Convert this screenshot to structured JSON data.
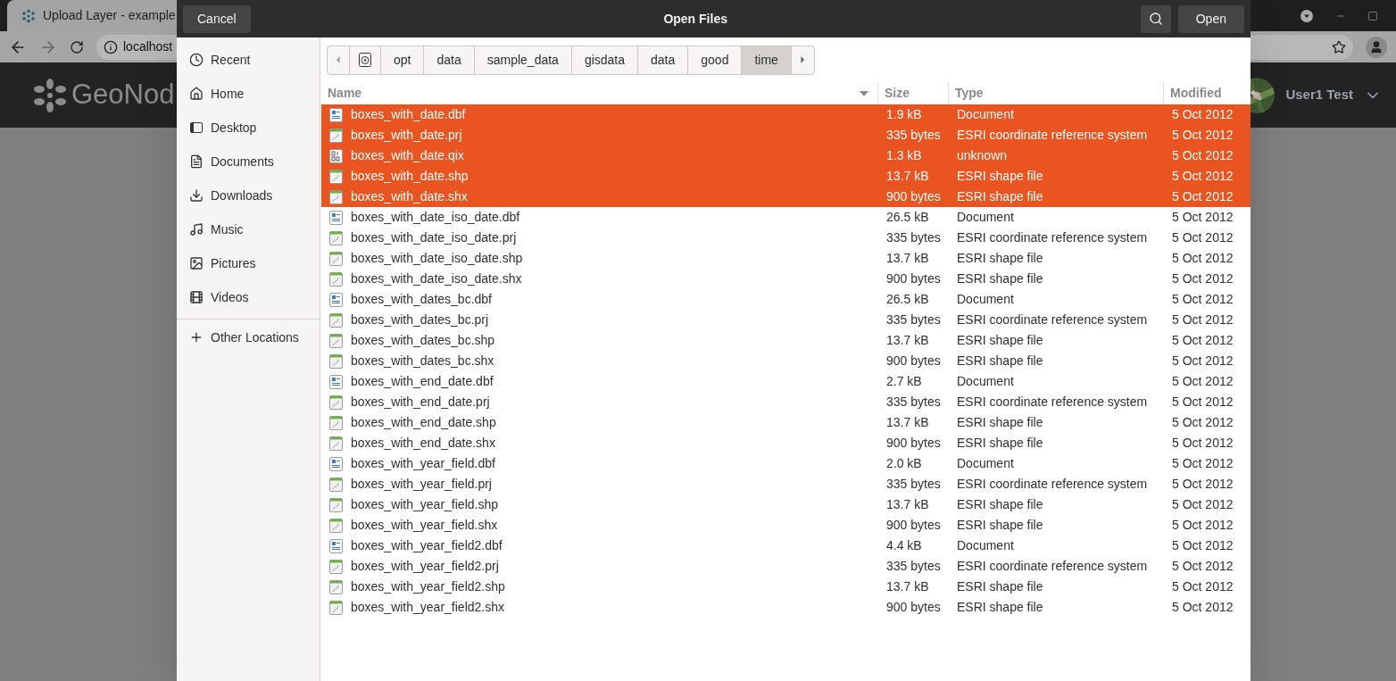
{
  "browser": {
    "tab_title": "Upload Layer - example",
    "address": "localhost",
    "site_logo": "GeoNod",
    "user_name": "User1 Test"
  },
  "dialog": {
    "title": "Open Files",
    "cancel": "Cancel",
    "open": "Open"
  },
  "sidebar": {
    "places": [
      {
        "label": "Recent",
        "kind": "recent"
      },
      {
        "label": "Home",
        "kind": "home"
      },
      {
        "label": "Desktop",
        "kind": "desktop"
      },
      {
        "label": "Documents",
        "kind": "documents"
      },
      {
        "label": "Downloads",
        "kind": "downloads"
      },
      {
        "label": "Music",
        "kind": "music"
      },
      {
        "label": "Pictures",
        "kind": "pictures"
      },
      {
        "label": "Videos",
        "kind": "videos"
      }
    ],
    "other": {
      "label": "Other Locations"
    }
  },
  "path_bar": [
    {
      "label": "opt",
      "selected": false
    },
    {
      "label": "data",
      "selected": false
    },
    {
      "label": "sample_data",
      "selected": false
    },
    {
      "label": "gisdata",
      "selected": false
    },
    {
      "label": "data",
      "selected": false
    },
    {
      "label": "good",
      "selected": false
    },
    {
      "label": "time",
      "selected": true
    }
  ],
  "table": {
    "columns": [
      "Name",
      "Size",
      "Type",
      "Modified"
    ],
    "rows": [
      {
        "name": "boxes_with_date.dbf",
        "kind": "document",
        "size": "1.9 kB",
        "type": "Document",
        "modified": "5 Oct 2012",
        "selected": true
      },
      {
        "name": "boxes_with_date.prj",
        "kind": "shape",
        "size": "335 bytes",
        "type": "ESRI coordinate reference system",
        "modified": "5 Oct 2012",
        "selected": true
      },
      {
        "name": "boxes_with_date.qix",
        "kind": "binary",
        "size": "1.3 kB",
        "type": "unknown",
        "modified": "5 Oct 2012",
        "selected": true
      },
      {
        "name": "boxes_with_date.shp",
        "kind": "shape",
        "size": "13.7 kB",
        "type": "ESRI shape file",
        "modified": "5 Oct 2012",
        "selected": true
      },
      {
        "name": "boxes_with_date.shx",
        "kind": "shape",
        "size": "900 bytes",
        "type": "ESRI shape file",
        "modified": "5 Oct 2012",
        "selected": true
      },
      {
        "name": "boxes_with_date_iso_date.dbf",
        "kind": "document",
        "size": "26.5 kB",
        "type": "Document",
        "modified": "5 Oct 2012",
        "selected": false
      },
      {
        "name": "boxes_with_date_iso_date.prj",
        "kind": "shape",
        "size": "335 bytes",
        "type": "ESRI coordinate reference system",
        "modified": "5 Oct 2012",
        "selected": false
      },
      {
        "name": "boxes_with_date_iso_date.shp",
        "kind": "shape",
        "size": "13.7 kB",
        "type": "ESRI shape file",
        "modified": "5 Oct 2012",
        "selected": false
      },
      {
        "name": "boxes_with_date_iso_date.shx",
        "kind": "shape",
        "size": "900 bytes",
        "type": "ESRI shape file",
        "modified": "5 Oct 2012",
        "selected": false
      },
      {
        "name": "boxes_with_dates_bc.dbf",
        "kind": "document",
        "size": "26.5 kB",
        "type": "Document",
        "modified": "5 Oct 2012",
        "selected": false
      },
      {
        "name": "boxes_with_dates_bc.prj",
        "kind": "shape",
        "size": "335 bytes",
        "type": "ESRI coordinate reference system",
        "modified": "5 Oct 2012",
        "selected": false
      },
      {
        "name": "boxes_with_dates_bc.shp",
        "kind": "shape",
        "size": "13.7 kB",
        "type": "ESRI shape file",
        "modified": "5 Oct 2012",
        "selected": false
      },
      {
        "name": "boxes_with_dates_bc.shx",
        "kind": "shape",
        "size": "900 bytes",
        "type": "ESRI shape file",
        "modified": "5 Oct 2012",
        "selected": false
      },
      {
        "name": "boxes_with_end_date.dbf",
        "kind": "document",
        "size": "2.7 kB",
        "type": "Document",
        "modified": "5 Oct 2012",
        "selected": false
      },
      {
        "name": "boxes_with_end_date.prj",
        "kind": "shape",
        "size": "335 bytes",
        "type": "ESRI coordinate reference system",
        "modified": "5 Oct 2012",
        "selected": false
      },
      {
        "name": "boxes_with_end_date.shp",
        "kind": "shape",
        "size": "13.7 kB",
        "type": "ESRI shape file",
        "modified": "5 Oct 2012",
        "selected": false
      },
      {
        "name": "boxes_with_end_date.shx",
        "kind": "shape",
        "size": "900 bytes",
        "type": "ESRI shape file",
        "modified": "5 Oct 2012",
        "selected": false
      },
      {
        "name": "boxes_with_year_field.dbf",
        "kind": "document",
        "size": "2.0 kB",
        "type": "Document",
        "modified": "5 Oct 2012",
        "selected": false
      },
      {
        "name": "boxes_with_year_field.prj",
        "kind": "shape",
        "size": "335 bytes",
        "type": "ESRI coordinate reference system",
        "modified": "5 Oct 2012",
        "selected": false
      },
      {
        "name": "boxes_with_year_field.shp",
        "kind": "shape",
        "size": "13.7 kB",
        "type": "ESRI shape file",
        "modified": "5 Oct 2012",
        "selected": false
      },
      {
        "name": "boxes_with_year_field.shx",
        "kind": "shape",
        "size": "900 bytes",
        "type": "ESRI shape file",
        "modified": "5 Oct 2012",
        "selected": false
      },
      {
        "name": "boxes_with_year_field2.dbf",
        "kind": "document",
        "size": "4.4 kB",
        "type": "Document",
        "modified": "5 Oct 2012",
        "selected": false
      },
      {
        "name": "boxes_with_year_field2.prj",
        "kind": "shape",
        "size": "335 bytes",
        "type": "ESRI coordinate reference system",
        "modified": "5 Oct 2012",
        "selected": false
      },
      {
        "name": "boxes_with_year_field2.shp",
        "kind": "shape",
        "size": "13.7 kB",
        "type": "ESRI shape file",
        "modified": "5 Oct 2012",
        "selected": false
      },
      {
        "name": "boxes_with_year_field2.shx",
        "kind": "shape",
        "size": "900 bytes",
        "type": "ESRI shape file",
        "modified": "5 Oct 2012",
        "selected": false
      }
    ]
  }
}
